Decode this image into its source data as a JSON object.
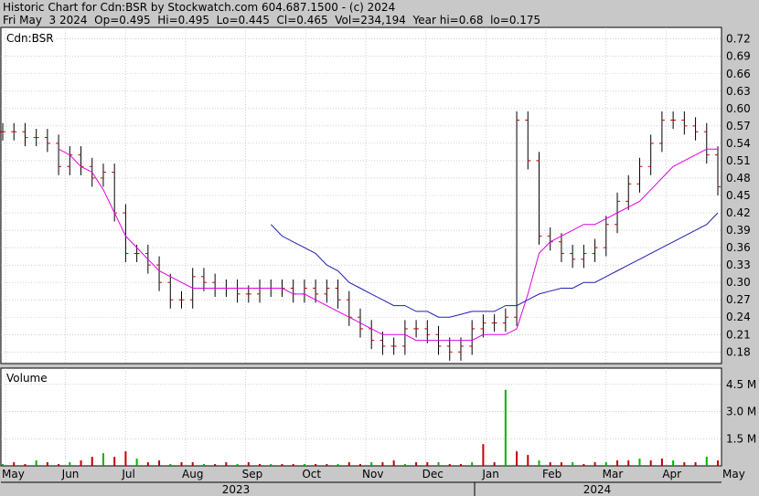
{
  "header": {
    "line1": "Historic Chart for Cdn:BSR by Stockwatch.com 604.687.1500 - (c) 2024",
    "line2": "Fri May  3 2024  Op=0.495  Hi=0.495  Lo=0.445  Cl=0.465  Vol=234,194  Year hi=0.68  lo=0.175"
  },
  "chart_data": [
    {
      "type": "ohlc",
      "title": "Cdn:BSR",
      "ylim": [
        0.16,
        0.74
      ],
      "y_ticks": [
        "0.72",
        "0.69",
        "0.66",
        "0.63",
        "0.60",
        "0.57",
        "0.54",
        "0.51",
        "0.48",
        "0.45",
        "0.42",
        "0.39",
        "0.36",
        "0.33",
        "0.30",
        "0.27",
        "0.24",
        "0.21",
        "0.18"
      ],
      "x_months": [
        "May",
        "Jun",
        "Jul",
        "Aug",
        "Sep",
        "Oct",
        "Nov",
        "Dec",
        "Jan",
        "Feb",
        "Mar",
        "Apr",
        "May"
      ],
      "x_years": [
        "2023",
        "2024"
      ],
      "grid": true,
      "price_weekly": [
        0.56,
        0.56,
        0.55,
        0.55,
        0.54,
        0.5,
        0.52,
        0.5,
        0.48,
        0.49,
        0.42,
        0.35,
        0.35,
        0.33,
        0.3,
        0.27,
        0.27,
        0.31,
        0.3,
        0.29,
        0.29,
        0.28,
        0.28,
        0.29,
        0.29,
        0.29,
        0.28,
        0.29,
        0.28,
        0.29,
        0.27,
        0.24,
        0.22,
        0.2,
        0.19,
        0.19,
        0.22,
        0.22,
        0.21,
        0.19,
        0.18,
        0.19,
        0.22,
        0.23,
        0.23,
        0.24,
        0.58,
        0.51,
        0.38,
        0.37,
        0.35,
        0.34,
        0.35,
        0.36,
        0.4,
        0.44,
        0.47,
        0.5,
        0.54,
        0.58,
        0.58,
        0.57,
        0.56,
        0.52,
        0.465
      ],
      "ma_short": [
        null,
        null,
        null,
        null,
        null,
        0.53,
        0.52,
        0.5,
        0.49,
        0.46,
        0.42,
        0.38,
        0.36,
        0.34,
        0.32,
        0.31,
        0.3,
        0.29,
        0.29,
        0.29,
        0.29,
        0.29,
        0.29,
        0.29,
        0.29,
        0.29,
        0.28,
        0.28,
        0.27,
        0.26,
        0.25,
        0.24,
        0.23,
        0.22,
        0.21,
        0.21,
        0.21,
        0.2,
        0.2,
        0.2,
        0.2,
        0.2,
        0.2,
        0.21,
        0.21,
        0.21,
        0.22,
        0.28,
        0.35,
        0.37,
        0.38,
        0.39,
        0.4,
        0.4,
        0.41,
        0.42,
        0.43,
        0.44,
        0.46,
        0.48,
        0.5,
        0.51,
        0.52,
        0.53,
        0.53
      ],
      "ma_long": [
        null,
        null,
        null,
        null,
        null,
        null,
        null,
        null,
        null,
        null,
        null,
        null,
        null,
        null,
        null,
        null,
        null,
        null,
        null,
        null,
        null,
        null,
        null,
        null,
        0.4,
        0.38,
        0.37,
        0.36,
        0.35,
        0.33,
        0.32,
        0.3,
        0.29,
        0.28,
        0.27,
        0.26,
        0.26,
        0.25,
        0.25,
        0.24,
        0.24,
        0.245,
        0.25,
        0.25,
        0.25,
        0.26,
        0.26,
        0.27,
        0.28,
        0.285,
        0.29,
        0.29,
        0.3,
        0.3,
        0.31,
        0.32,
        0.33,
        0.34,
        0.35,
        0.36,
        0.37,
        0.38,
        0.39,
        0.4,
        0.42
      ]
    },
    {
      "type": "bar",
      "title": "Volume",
      "y_ticks": [
        "4.5 M",
        "3.0 M",
        "1.5 M"
      ],
      "ylim": [
        0,
        5.4
      ],
      "volume_weekly_millions": [
        0.1,
        0.2,
        0.1,
        0.3,
        0.2,
        0.1,
        0.2,
        0.3,
        0.5,
        0.7,
        0.5,
        0.8,
        0.4,
        0.2,
        0.3,
        0.1,
        0.2,
        0.2,
        0.1,
        0.1,
        0.2,
        0.1,
        0.2,
        0.1,
        0.1,
        0.1,
        0.1,
        0.1,
        0.1,
        0.1,
        0.1,
        0.2,
        0.1,
        0.2,
        0.2,
        0.3,
        0.1,
        0.2,
        0.2,
        0.2,
        0.1,
        0.1,
        0.2,
        1.2,
        0.2,
        4.2,
        0.8,
        0.6,
        0.3,
        0.2,
        0.2,
        0.2,
        0.1,
        0.2,
        0.2,
        0.3,
        0.3,
        0.4,
        0.3,
        0.4,
        0.3,
        0.2,
        0.2,
        0.5,
        0.3
      ]
    }
  ]
}
